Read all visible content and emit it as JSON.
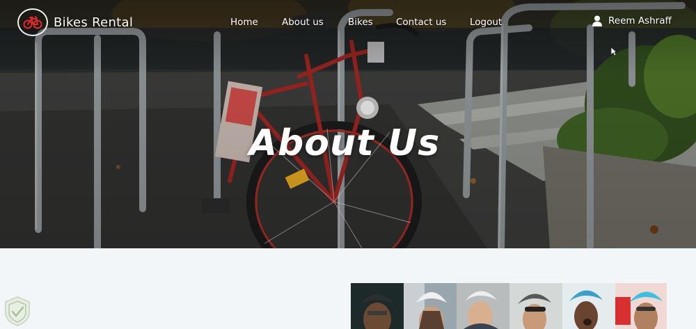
{
  "brand": {
    "name": "Bikes Rental",
    "logo_icon": "bicycle-logo-icon"
  },
  "nav": {
    "items": [
      {
        "label": "Home"
      },
      {
        "label": "About us"
      },
      {
        "label": "Bikes"
      },
      {
        "label": "Contact us"
      },
      {
        "label": "Logout"
      }
    ]
  },
  "user": {
    "name": "Reem Ashraff",
    "icon": "user-icon"
  },
  "hero": {
    "title": "About Us"
  },
  "colors": {
    "brand_red": "#c8242b",
    "text_light": "#ffffff",
    "page_bg": "#f3f6f9"
  },
  "photos": [
    {
      "icon": "cyclist-photo"
    },
    {
      "icon": "cyclist-photo"
    },
    {
      "icon": "cyclist-photo"
    },
    {
      "icon": "cyclist-photo"
    },
    {
      "icon": "cyclist-photo"
    },
    {
      "icon": "cyclist-photo"
    }
  ]
}
